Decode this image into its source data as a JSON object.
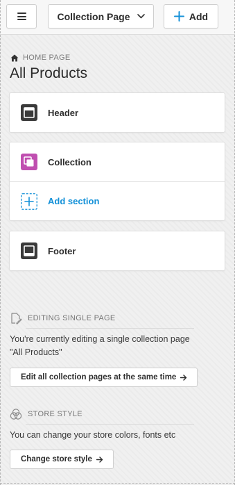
{
  "toolbar": {
    "page_selector_label": "Collection Page",
    "add_label": "Add"
  },
  "breadcrumb": {
    "label": "HOME PAGE"
  },
  "page_title": "All Products",
  "sections": {
    "header_label": "Header",
    "collection_label": "Collection",
    "add_section_label": "Add section",
    "footer_label": "Footer"
  },
  "editing": {
    "heading": "EDITING SINGLE PAGE",
    "line1": "You're currently editing a single collection page",
    "line2": "\"All Products\"",
    "button_label": "Edit all collection pages at the same time"
  },
  "store_style": {
    "heading": "STORE STYLE",
    "text": "You can change your store colors, fonts etc",
    "button_label": "Change store style"
  },
  "colors": {
    "accent": "#1491d8",
    "collection_icon": "#c04fb0",
    "dark_icon": "#3a3a3a"
  }
}
